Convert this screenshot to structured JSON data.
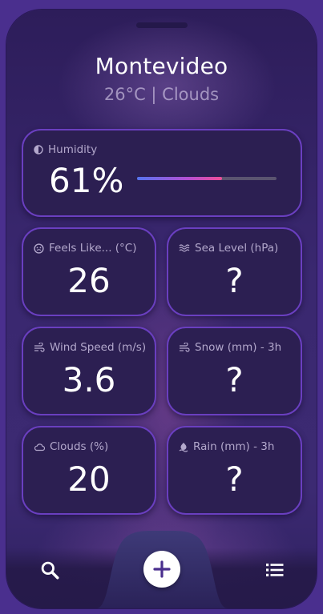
{
  "header": {
    "city": "Montevideo",
    "summary": "26°C | Clouds"
  },
  "humidity": {
    "label": "Humidity",
    "value": "61%",
    "level": 0.61,
    "icon": "contrast-half-icon"
  },
  "cards": [
    {
      "id": "feels-like",
      "label": "Feels Like... (°C)",
      "value": "26",
      "icon": "face-icon"
    },
    {
      "id": "sea-level",
      "label": "Sea Level (hPa)",
      "value": "?",
      "icon": "waves-icon"
    },
    {
      "id": "wind-speed",
      "label": "Wind Speed (m/s)",
      "value": "3.6",
      "icon": "wind-icon"
    },
    {
      "id": "snow",
      "label": "Snow (mm) - 3h",
      "value": "?",
      "icon": "wind-icon"
    },
    {
      "id": "clouds",
      "label": "Clouds (%)",
      "value": "20",
      "icon": "cloud-icon"
    },
    {
      "id": "rain",
      "label": "Rain (mm) - 3h",
      "value": "?",
      "icon": "umbrella-drop-icon"
    }
  ],
  "nav": {
    "items": [
      "search-icon",
      "plus-circle-icon",
      "list-icon"
    ]
  },
  "colors": {
    "background": "#3a2870",
    "card": "#2c1f52",
    "card_border": "#6a3fc0",
    "bar_start": "#5574f0",
    "bar_end": "#ee4e98",
    "nav_accent": "#4a2f8e"
  }
}
